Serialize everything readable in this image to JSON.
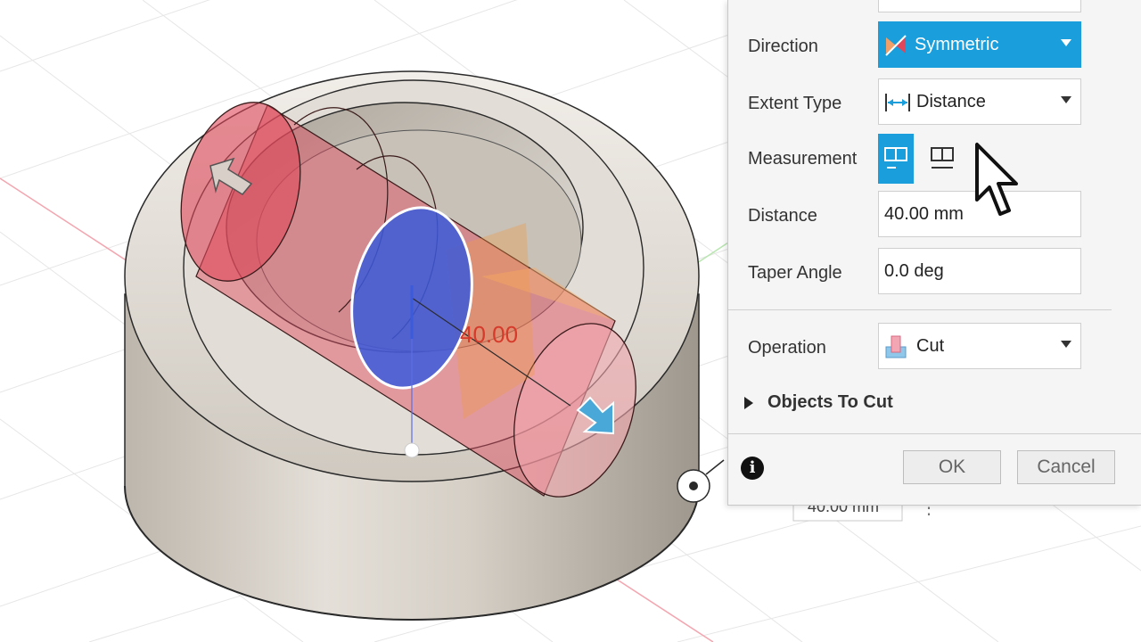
{
  "viewport": {
    "dimension_label": "40.00",
    "distance_box_value": "40.00 mm"
  },
  "panel": {
    "direction": {
      "label": "Direction",
      "value": "Symmetric"
    },
    "extent_type": {
      "label": "Extent Type",
      "value": "Distance"
    },
    "measurement": {
      "label": "Measurement",
      "selected": "half-length",
      "icons": [
        "measurement-half-icon",
        "measurement-whole-icon"
      ]
    },
    "distance": {
      "label": "Distance",
      "value": "40.00 mm"
    },
    "taper_angle": {
      "label": "Taper Angle",
      "value": "0.0 deg"
    },
    "operation": {
      "label": "Operation",
      "value": "Cut"
    },
    "objects_to_cut": {
      "label": "Objects To Cut"
    },
    "ok_label": "OK",
    "cancel_label": "Cancel"
  },
  "colors": {
    "accent": "#1a9fdc",
    "profile_blue": "#3b5bdb",
    "cut_red": "#e0475a"
  }
}
